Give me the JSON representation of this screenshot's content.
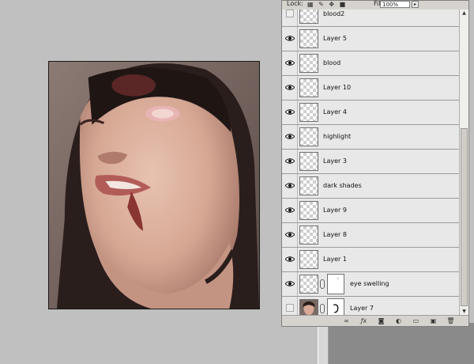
{
  "lock_bar": {
    "lock_label": "Lock:",
    "fill_label": "Fill:",
    "fill_value": "100%",
    "fill_arrow": "▸"
  },
  "layers": [
    {
      "name": "blood2",
      "visible": false,
      "thumb": "transparent",
      "has_mask": false
    },
    {
      "name": "Layer 5",
      "visible": true,
      "thumb": "transparent",
      "has_mask": false
    },
    {
      "name": "blood",
      "visible": true,
      "thumb": "transparent",
      "has_mask": false
    },
    {
      "name": "Layer 10",
      "visible": true,
      "thumb": "transparent",
      "has_mask": false
    },
    {
      "name": "Layer 4",
      "visible": true,
      "thumb": "transparent",
      "has_mask": false
    },
    {
      "name": "highlight",
      "visible": true,
      "thumb": "transparent",
      "has_mask": false
    },
    {
      "name": "Layer 3",
      "visible": true,
      "thumb": "transparent",
      "has_mask": false
    },
    {
      "name": "dark shades",
      "visible": true,
      "thumb": "transparent",
      "has_mask": false
    },
    {
      "name": "Layer 9",
      "visible": true,
      "thumb": "transparent",
      "has_mask": false
    },
    {
      "name": "Layer 8",
      "visible": true,
      "thumb": "transparent",
      "has_mask": false
    },
    {
      "name": "Layer 1",
      "visible": true,
      "thumb": "transparent",
      "has_mask": false
    },
    {
      "name": "eye swelling",
      "visible": true,
      "thumb": "transparent",
      "has_mask": true
    },
    {
      "name": "Layer 7",
      "visible": false,
      "thumb": "photo",
      "has_mask": true
    }
  ],
  "toolbar_icons": [
    "link-layers-icon",
    "layer-style-icon",
    "add-mask-icon",
    "adjustment-layer-icon",
    "new-group-icon",
    "new-layer-icon",
    "delete-layer-icon"
  ],
  "colors": {
    "panel_bg": "#d6d3ce",
    "row_bg": "#e8e8e8",
    "workspace": "#c0c0c0"
  }
}
